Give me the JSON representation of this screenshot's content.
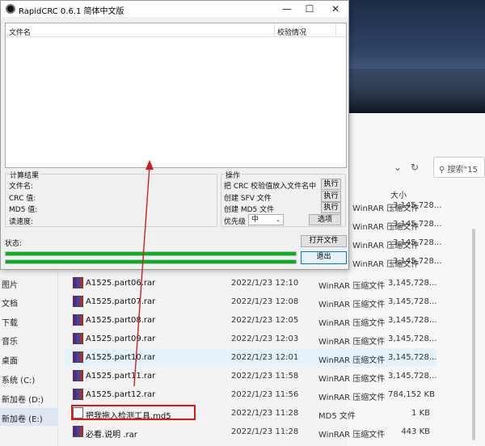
{
  "window": {
    "title": "RapidCRC 0.6.1 简体中文版",
    "minimize": "—",
    "maximize": "☐",
    "close": "✕"
  },
  "list": {
    "col_filename": "文件名",
    "col_check": "校验情况"
  },
  "results": {
    "group_title": "计算结果",
    "filename_label": "文件名:",
    "crc_label": "CRC 值:",
    "md5_label": "MD5 值:",
    "speed_label": "读速度:"
  },
  "ops": {
    "group_title": "操作",
    "op1": "把 CRC 校验值放入文件名中",
    "op2": "创建 SFV 文件",
    "op3": "创建 MD5 文件",
    "priority_label": "优先级",
    "priority_value": "中",
    "exec_label": "执行",
    "options_label": "选项"
  },
  "status": {
    "label": "状态:",
    "open_file": "打开文件",
    "exit": "退出",
    "progress1": 1.0,
    "progress2": 1.0
  },
  "explorer": {
    "search_placeholder": "搜索\"15",
    "size_header": "大小",
    "sidebar": [
      "图片",
      "文档",
      "下载",
      "音乐",
      "桌面",
      "系统 (C:)",
      "新加卷 (D:)",
      "新加卷 (E:)"
    ],
    "stub_rows": [
      {
        "type": "WinRAR 压缩文件",
        "size": "3,145,728..."
      },
      {
        "type": "WinRAR 压缩文件",
        "size": "3,145,728..."
      },
      {
        "type": "WinRAR 压缩文件",
        "size": "3,145,728..."
      },
      {
        "type": "WinRAR 压缩文件",
        "size": "3,145,728..."
      }
    ],
    "files": [
      {
        "name": "A1525.part06.rar",
        "date": "2022/1/23 12:10",
        "type": "WinRAR 压缩文件",
        "size": "3,145,728..."
      },
      {
        "name": "A1525.part07.rar",
        "date": "2022/1/23 12:08",
        "type": "WinRAR 压缩文件",
        "size": "3,145,728..."
      },
      {
        "name": "A1525.part08.rar",
        "date": "2022/1/23 12:05",
        "type": "WinRAR 压缩文件",
        "size": "3,145,728..."
      },
      {
        "name": "A1525.part09.rar",
        "date": "2022/1/23 12:03",
        "type": "WinRAR 压缩文件",
        "size": "3,145,728..."
      },
      {
        "name": "A1525.part10.rar",
        "date": "2022/1/23 12:01",
        "type": "WinRAR 压缩文件",
        "size": "3,145,728..."
      },
      {
        "name": "A1525.part11.rar",
        "date": "2022/1/23 11:58",
        "type": "WinRAR 压缩文件",
        "size": "3,145,728..."
      },
      {
        "name": "A1525.part12.rar",
        "date": "2022/1/23 11:56",
        "type": "WinRAR 压缩文件",
        "size": "784,152 KB"
      },
      {
        "name": "把我拖入检测工具.md5",
        "date": "2022/1/23 11:28",
        "type": "MD5 文件",
        "size": "1 KB"
      },
      {
        "name": "必看.说明 .rar",
        "date": "2022/1/23 11:28",
        "type": "WinRAR 压缩文件",
        "size": "443 KB"
      }
    ]
  },
  "colors": {
    "progress": "#06b025",
    "highlight_box": "#e0141b",
    "arrow": "#cc2020"
  }
}
